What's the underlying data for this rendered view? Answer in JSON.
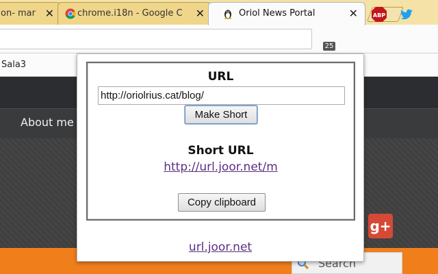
{
  "browser": {
    "tabs": [
      {
        "title": "on- mar",
        "active": false
      },
      {
        "title": "chrome.i18n - Google C",
        "active": false
      },
      {
        "title": "Oriol News Portal",
        "active": true
      }
    ],
    "bookmarks": [
      "Sala3"
    ],
    "extension_badge": "25",
    "abp_label": "ABP"
  },
  "page_behind": {
    "nav_item": "About me",
    "search_placeholder": "Search",
    "gplus_label": "g+"
  },
  "popup": {
    "url_heading": "URL",
    "url_value": "http://oriolrius.cat/blog/",
    "make_short_label": "Make Short",
    "short_heading": "Short URL",
    "short_url": "http://url.joor.net/m",
    "copy_label": "Copy clipboard",
    "footer_link": "url.joor.net"
  },
  "colors": {
    "tab_inactive": "#f0d68a",
    "link": "#5a2d82",
    "abp_red": "#c3151b",
    "twitter_blue": "#1da1f2",
    "star_blue": "#3b7bea"
  }
}
